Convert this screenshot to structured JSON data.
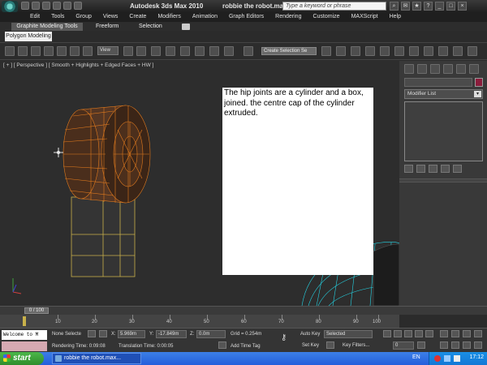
{
  "window": {
    "app_title": "Autodesk 3ds Max  2010",
    "file_title": "robbie the robot.max"
  },
  "search": {
    "placeholder": "Type a keyword or phrase"
  },
  "menu": [
    "Edit",
    "Tools",
    "Group",
    "Views",
    "Create",
    "Modifiers",
    "Animation",
    "Graph Editors",
    "Rendering",
    "Customize",
    "MAXScript",
    "Help"
  ],
  "ribbon": {
    "tab_graphite": "Graphite Modeling Tools",
    "tab_freeform": "Freeform",
    "tab_selection": "Selection",
    "subtab": "Polygon Modeling"
  },
  "toolbar": {
    "view_dropdown": "View",
    "selection_set": "Create Selection Se"
  },
  "viewport": {
    "label": "[ + ] [ Perspective ] [ Smooth + Highlights + Edged Faces + HW ]"
  },
  "note": {
    "text": "The hip joints are a cylinder and a box, joined. the centre cap of the cylinder extruded."
  },
  "command_panel": {
    "modifier_list": "Modifier List"
  },
  "timeline": {
    "frame": "0 / 100",
    "ticks": [
      "10",
      "20",
      "30",
      "40",
      "50",
      "60",
      "70",
      "80",
      "90",
      "100"
    ]
  },
  "status": {
    "maxscript": "Welcome to M",
    "selection": "None Selecte",
    "x_label": "X:",
    "x_value": "5.969m",
    "y_label": "Y:",
    "y_value": "-17.849m",
    "z_label": "Z:",
    "z_value": "0.0m",
    "grid": "Grid = 0.254m",
    "rendering_time": "Rendering Time: 0:09:08",
    "translation_time": "Translation Time: 0:00:05",
    "add_time_tag": "Add Time Tag",
    "auto_key": "Auto Key",
    "auto_key_value": "Selected",
    "set_key": "Set Key",
    "key_filters": "Key Filters...",
    "frame_value": "0"
  },
  "taskbar": {
    "start": "start",
    "task": "robbie the robot.max...",
    "lang": "EN",
    "clock": "17:12"
  },
  "colors": {
    "wire_orange": "#e07a1e",
    "wire_yellow": "#c9b04a",
    "wire_cyan": "#25d6e6",
    "object_color": "#8b1d3c"
  }
}
